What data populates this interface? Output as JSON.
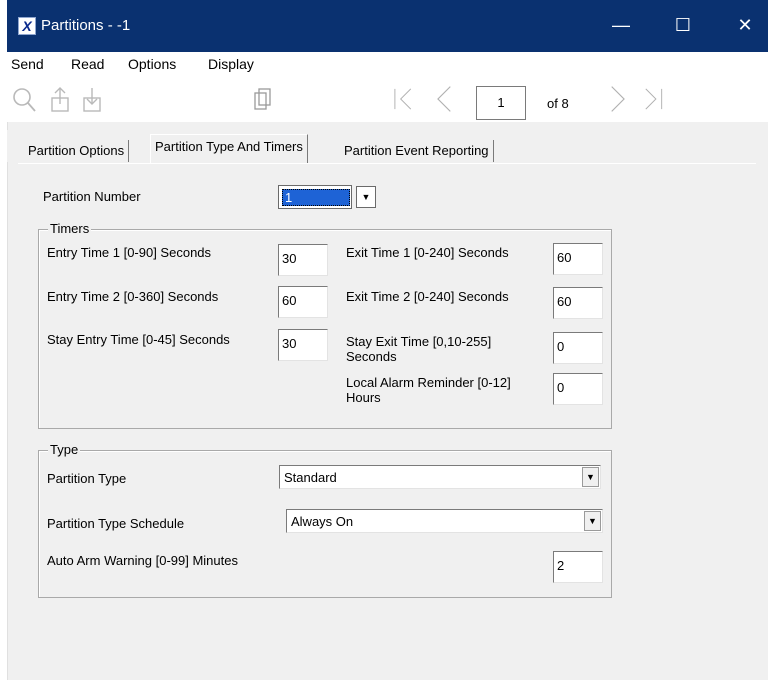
{
  "window": {
    "title": "Partitions - -1",
    "minimize_glyph": "—",
    "maximize_glyph": "☐",
    "close_glyph": "✕"
  },
  "menu": [
    "Send",
    "Read",
    "Options",
    "Display"
  ],
  "toolbar": {
    "page_current": "1",
    "page_of": "of 8",
    "icons": [
      "search-icon",
      "upload-icon",
      "download-icon",
      "copy-icon",
      "first-page-icon",
      "previous-page-icon",
      "next-page-icon",
      "last-page-icon"
    ]
  },
  "tabs": [
    {
      "label": "Partition Options",
      "active": false
    },
    {
      "label": "Partition Type And Timers",
      "active": true
    },
    {
      "label": "Partition Event Reporting",
      "active": false
    }
  ],
  "partition_number": {
    "label": "Partition Number",
    "value": "1"
  },
  "timers": {
    "title": "Timers",
    "entry_time_1": {
      "label": "Entry Time 1 [0-90] Seconds",
      "value": "30"
    },
    "entry_time_2": {
      "label": "Entry Time 2 [0-360] Seconds",
      "value": "60"
    },
    "stay_entry_time": {
      "label": "Stay Entry Time [0-45] Seconds",
      "value": "30"
    },
    "exit_time_1": {
      "label": "Exit Time 1 [0-240] Seconds",
      "value": "60"
    },
    "exit_time_2": {
      "label": "Exit Time 2 [0-240] Seconds",
      "value": "60"
    },
    "stay_exit_time": {
      "label": "Stay Exit Time [0,10-255] Seconds",
      "value": "0"
    },
    "local_alarm_reminder": {
      "label": "Local Alarm Reminder [0-12] Hours",
      "value": "0"
    }
  },
  "type": {
    "title": "Type",
    "partition_type": {
      "label": "Partition Type",
      "value": "Standard"
    },
    "partition_type_schedule": {
      "label": "Partition Type Schedule",
      "value": "Always On"
    },
    "auto_arm_warning": {
      "label": "Auto Arm Warning [0-99] Minutes",
      "value": "2"
    }
  },
  "colors": {
    "titlebar": "#0a3170",
    "panel": "#f0f0f0",
    "selection": "#1e63d6"
  }
}
